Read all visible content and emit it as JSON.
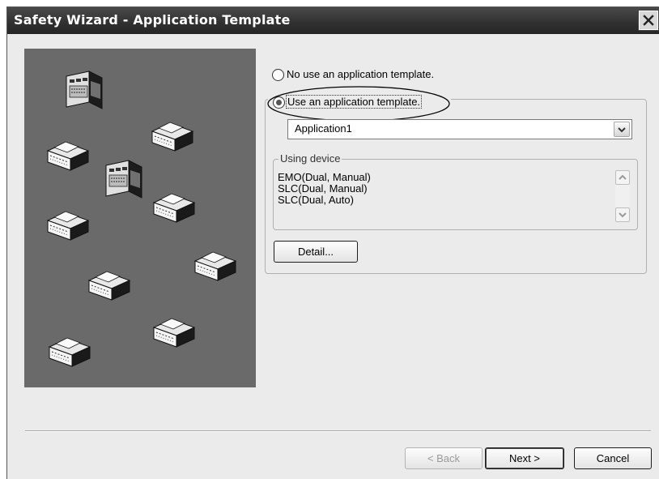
{
  "window": {
    "title": "Safety Wizard - Application Template"
  },
  "options": {
    "no_use_label": "No use an application template.",
    "use_label": "Use an application template.",
    "selected": "use"
  },
  "template_select": {
    "value": "Application1"
  },
  "using_device": {
    "legend": "Using device",
    "items": [
      "EMO(Dual, Manual)",
      "SLC(Dual, Manual)",
      "SLC(Dual, Auto)"
    ]
  },
  "buttons": {
    "detail": "Detail...",
    "back": "< Back",
    "next": "Next >",
    "cancel": "Cancel"
  },
  "icons": {
    "close": "close-icon",
    "dropdown": "chevron-down-icon",
    "device": "safety-device-icon",
    "controller": "controller-icon"
  },
  "colors": {
    "titlebar": "#303030",
    "canvas": "#6a6a6a",
    "dialog": "#ebebeb"
  }
}
